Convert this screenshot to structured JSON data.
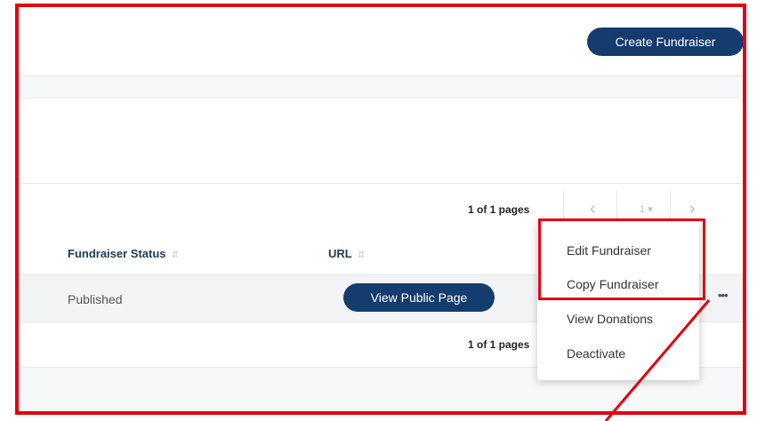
{
  "header": {
    "create_label": "Create Fundraiser"
  },
  "pagination": {
    "top_text": "1 of 1 pages",
    "bottom_text": "1 of 1 pages",
    "prev_icon": "chevron-left-icon",
    "page_value": "1",
    "next_icon": "chevron-right-icon"
  },
  "table": {
    "columns": [
      {
        "label": "Fundraiser Status",
        "sort_icon": "sort-icon"
      },
      {
        "label": "URL",
        "sort_icon": "sort-icon"
      }
    ],
    "rows": [
      {
        "status": "Published",
        "url_button": "View Public Page",
        "more": "•••"
      }
    ]
  },
  "context_menu": {
    "items": [
      "Edit Fundraiser",
      "Copy Fundraiser",
      "View Donations",
      "Deactivate"
    ]
  },
  "annotation": {
    "color": "#e3000f"
  },
  "colors": {
    "brand": "#143c6e",
    "annotation": "#e3000f"
  }
}
